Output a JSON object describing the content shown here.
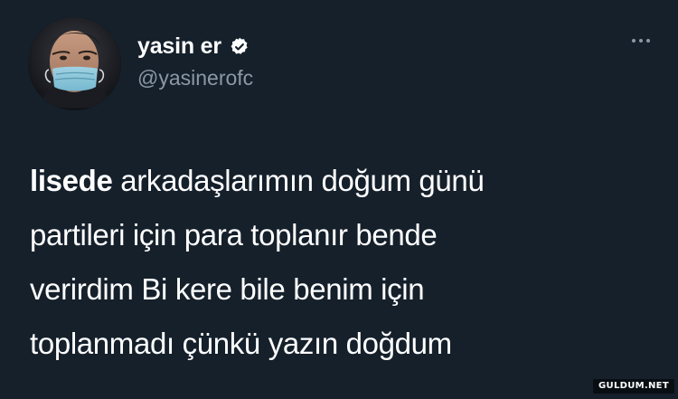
{
  "tweet": {
    "author": {
      "display_name": "yasin er",
      "handle": "@yasinerofc",
      "verified": true,
      "avatar_icon": "profile-photo-face-mask"
    },
    "more_icon": "more-dots-icon",
    "text_lines": [
      {
        "bold": "lisede",
        "rest": " arkadaşlarımın doğum günü"
      },
      {
        "bold": "",
        "rest": "partileri için para toplanır bende"
      },
      {
        "bold": "",
        "rest": "verirdim Bi kere bile benim için"
      },
      {
        "bold": "",
        "rest": "toplanmadı çünkü yazın doğdum"
      }
    ]
  },
  "watermark": {
    "text": "GULDUM.NET"
  },
  "colors": {
    "background": "#15202b",
    "text_primary": "#ffffff",
    "text_secondary": "#8b98a5",
    "verified_badge": "#ffffff"
  }
}
